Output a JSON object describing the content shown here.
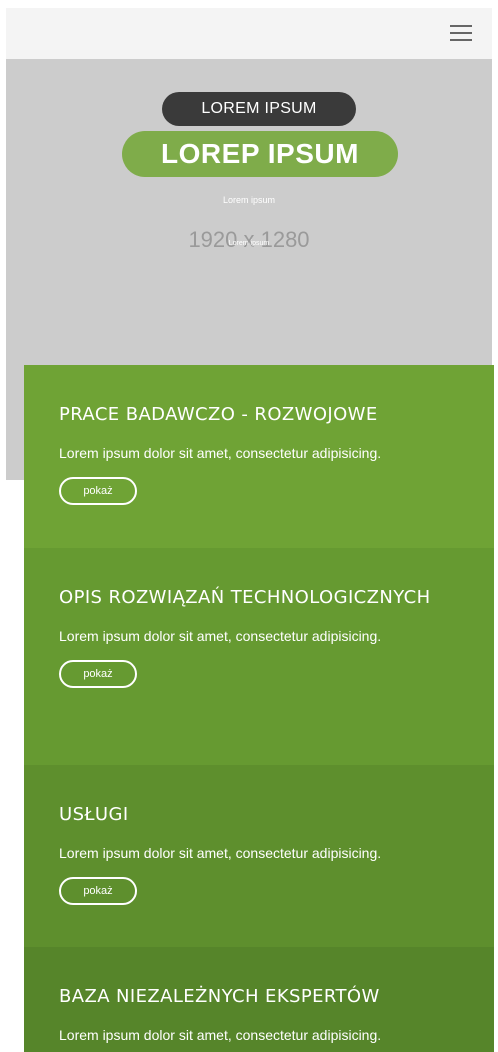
{
  "hero": {
    "kicker": "LOREM IPSUM",
    "title": "LOREP IPSUM",
    "subtitle": "Lorem ipsum",
    "placeholder_size": "1920 x 1280",
    "placeholder_overlay": "Lorem ipsum"
  },
  "cards": [
    {
      "title": "PRACE BADAWCZO - ROZWOJOWE",
      "text": "Lorem ipsum dolor sit amet, consectetur adipisicing.",
      "button": "pokaż"
    },
    {
      "title": "OPIS ROZWIĄZAŃ TECHNOLOGICZNYCH",
      "text": "Lorem ipsum dolor sit amet, consectetur adipisicing.",
      "button": "pokaż"
    },
    {
      "title": "USŁUGI",
      "text": "Lorem ipsum dolor sit amet, consectetur adipisicing.",
      "button": "pokaż"
    },
    {
      "title": "BAZA NIEZALEŻNYCH EKSPERTÓW",
      "text": "Lorem ipsum dolor sit amet, consectetur adipisicing."
    }
  ],
  "icons": {
    "menu": "hamburger-menu-icon"
  },
  "colors": {
    "brand_green": "#7fac4a",
    "card_green_1": "#6fa335",
    "card_green_2": "#669a31",
    "card_green_3": "#5e8f2d",
    "card_green_4": "#56852a",
    "hero_bg": "#cccccc",
    "dark_pill": "#3a3a3a"
  }
}
